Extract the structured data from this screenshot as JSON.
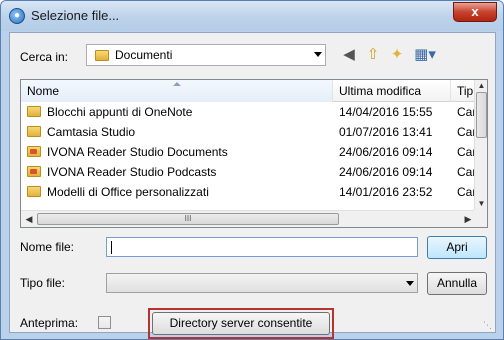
{
  "window": {
    "title": "Selezione file...",
    "close_glyph": "x"
  },
  "look_in": {
    "label": "Cerca in:",
    "value": "Documenti"
  },
  "toolbar": {
    "icons": [
      "back-icon",
      "up-folder-icon",
      "new-folder-icon",
      "view-menu-icon"
    ]
  },
  "file_list": {
    "columns": [
      "Nome",
      "Ultima modifica",
      "Tip"
    ],
    "rows": [
      {
        "name": "Blocchi appunti di OneNote",
        "date": "14/04/2016 15:55",
        "type": "Car",
        "icon": "folder-icon"
      },
      {
        "name": "Camtasia Studio",
        "date": "01/07/2016 13:41",
        "type": "Car",
        "icon": "folder-icon"
      },
      {
        "name": "IVONA Reader Studio Documents",
        "date": "24/06/2016 09:14",
        "type": "Car",
        "icon": "special-folder-icon"
      },
      {
        "name": "IVONA Reader Studio Podcasts",
        "date": "24/06/2016 09:14",
        "type": "Car",
        "icon": "special-folder-icon"
      },
      {
        "name": "Modelli di Office personalizzati",
        "date": "14/01/2016 23:52",
        "type": "Car",
        "icon": "folder-icon"
      }
    ],
    "hscroll_thumb_grip": "III"
  },
  "file_name": {
    "label": "Nome file:",
    "value": ""
  },
  "file_type": {
    "label": "Tipo file:",
    "value": ""
  },
  "buttons": {
    "open": "Apri",
    "cancel": "Annulla",
    "directory": "Directory server consentite"
  },
  "preview": {
    "label": "Anteprima:",
    "checked": false
  },
  "colors": {
    "title_bar": "#bcd2ea",
    "close_button": "#c7432e",
    "dialog_background": "#f0f0f0",
    "highlight_border": "#b83232",
    "folder_yellow": "#e2b23a"
  }
}
